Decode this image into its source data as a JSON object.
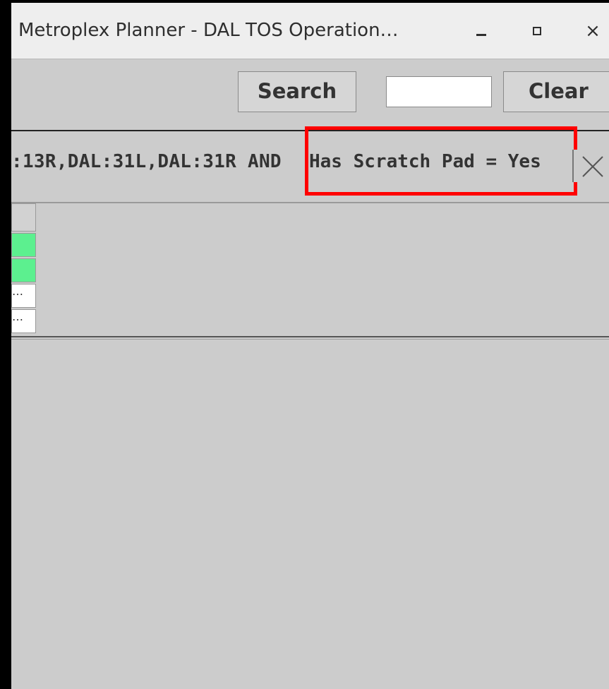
{
  "window": {
    "title": "Metroplex Planner - DAL TOS Operation…",
    "minimize_icon": "minimize-icon",
    "maximize_icon": "maximize-icon",
    "close_glyph": "×"
  },
  "toolbar": {
    "search_label": "Search",
    "search_input_value": "",
    "clear_label": "Clear"
  },
  "filter": {
    "text_prefix": ":13R,DAL:31L,DAL:31R AND",
    "text_highlight": "Has Scratch Pad =  Yes",
    "remove_icon": "close-x-icon",
    "highlight_color": "#ff0000"
  },
  "table": {
    "rows": [
      {
        "status": "green",
        "text": ""
      },
      {
        "status": "green",
        "text": ""
      },
      {
        "status": "white",
        "text": "…"
      },
      {
        "status": "white",
        "text": "…"
      }
    ]
  },
  "colors": {
    "background": "#cccccc",
    "row_green": "#5cf08f",
    "highlight": "#ff0000"
  }
}
